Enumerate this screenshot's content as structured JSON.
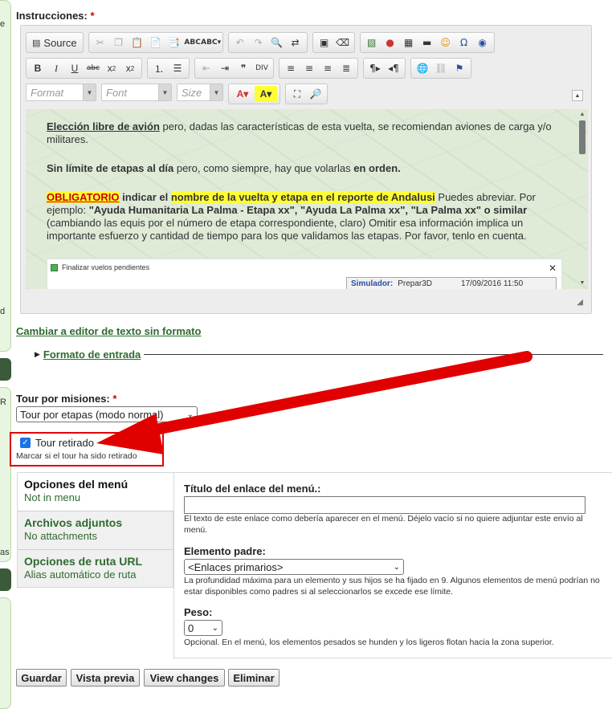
{
  "instrucciones": {
    "label": "Instrucciones:",
    "required": "*"
  },
  "toolbar": {
    "source_label": "Source",
    "format_placeholder": "Format",
    "font_placeholder": "Font",
    "size_placeholder": "Size"
  },
  "content": {
    "p1_lead": "Elección libre de avión",
    "p1_rest": " pero, dadas las características de esta vuelta, se recomiendan aviones de carga y/o militares.",
    "p2_lead": "Sin límite de etapas al día",
    "p2_mid": " pero, como siempre, hay que volarlas ",
    "p2_bold": "en orden.",
    "p3_oblig": "OBLIGATORIO",
    "p3_a": " indicar el ",
    "p3_hl": "nombre de la vuelta y etapa en el reporte de Andalusi",
    "p3_b": " Puedes abreviar. Por ejemplo: ",
    "p3_examples": "\"Ayuda Humanitaria La Palma - Etapa xx\", \"Ayuda La Palma xx\", \"La Palma xx\" o similar",
    "p3_c": " (cambiando las equis por el número de etapa correspondiente, claro) Omitir esa información implica un importante esfuerzo y cantidad de tiempo para los que validamos las etapas. Por favor, tenlo en cuenta.",
    "screenshot_title": "Finalizar vuelos pendientes",
    "screenshot_sim_label": "Simulador:",
    "screenshot_sim_value": "Prepar3D",
    "screenshot_date": "17/09/2016 11:50"
  },
  "links": {
    "plain_editor": "Cambiar a editor de texto sin formato",
    "input_format": "Formato de entrada"
  },
  "tour_misiones": {
    "label": "Tour por misiones:",
    "required": "*",
    "selected": "Tour por etapas (modo normal)"
  },
  "tour_retirado": {
    "label": "Tour retirado",
    "description": "Marcar si el tour ha sido retirado",
    "checked": true
  },
  "vertical_tabs": [
    {
      "title": "Opciones del menú",
      "summary": "Not in menu"
    },
    {
      "title": "Archivos adjuntos",
      "summary": "No attachments"
    },
    {
      "title": "Opciones de ruta URL",
      "summary": "Alias automático de ruta"
    }
  ],
  "menu_panel": {
    "link_title_label": "Título del enlace del menú.:",
    "link_title_value": "",
    "link_title_desc": "El texto de este enlace como debería aparecer en el menú. Déjelo vacío si no quiere adjuntar este envío al menú.",
    "parent_label": "Elemento padre:",
    "parent_selected": "<Enlaces primarios>",
    "parent_desc": "La profundidad máxima para un elemento y sus hijos se ha fijado en 9. Algunos elementos de menú podrían no estar disponibles como padres si al seleccionarlos se excede ese límite.",
    "weight_label": "Peso:",
    "weight_selected": "0",
    "weight_desc": "Opcional. En el menú, los elementos pesados se hunden y los ligeros flotan hacia la zona superior."
  },
  "buttons": {
    "save": "Guardar",
    "preview": "Vista previa",
    "changes": "View changes",
    "delete": "Eliminar"
  },
  "left_strip_chars": [
    "e",
    "d",
    "R",
    "as"
  ],
  "colors": {
    "annotation_red": "#e00000",
    "link_green": "#2e6b2e",
    "highlight": "#ffff33"
  }
}
